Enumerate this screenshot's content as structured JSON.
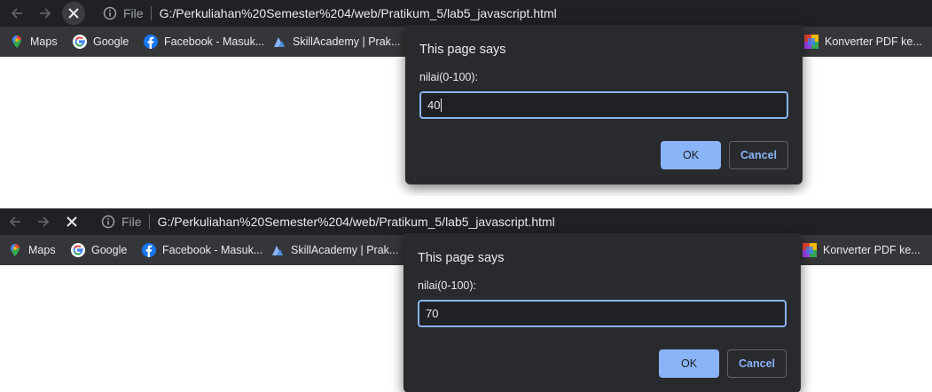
{
  "browser": {
    "scheme_label": "File",
    "url": "G:/Perkuliahan%20Semester%204/web/Pratikum_5/lab5_javascript.html"
  },
  "bookmarks": [
    {
      "label": "Maps",
      "icon": "maps-icon"
    },
    {
      "label": "Google",
      "icon": "google-icon"
    },
    {
      "label": "Facebook - Masuk...",
      "icon": "facebook-icon"
    },
    {
      "label": "SkillAcademy | Prak...",
      "icon": "skillacademy-icon"
    },
    {
      "label": "Konverter PDF ke...",
      "icon": "pdf-converter-icon"
    }
  ],
  "prompts": [
    {
      "title": "This page says",
      "label": "nilai(0-100):",
      "value": "40",
      "ok": "OK",
      "cancel": "Cancel"
    },
    {
      "title": "This page says",
      "label": "nilai(0-100):",
      "value": "70",
      "ok": "OK",
      "cancel": "Cancel"
    }
  ],
  "colors": {
    "toolbar": "#202124",
    "bookmarks_bar": "#35363a",
    "dialog": "#292a2d",
    "accent": "#8ab4f8"
  }
}
